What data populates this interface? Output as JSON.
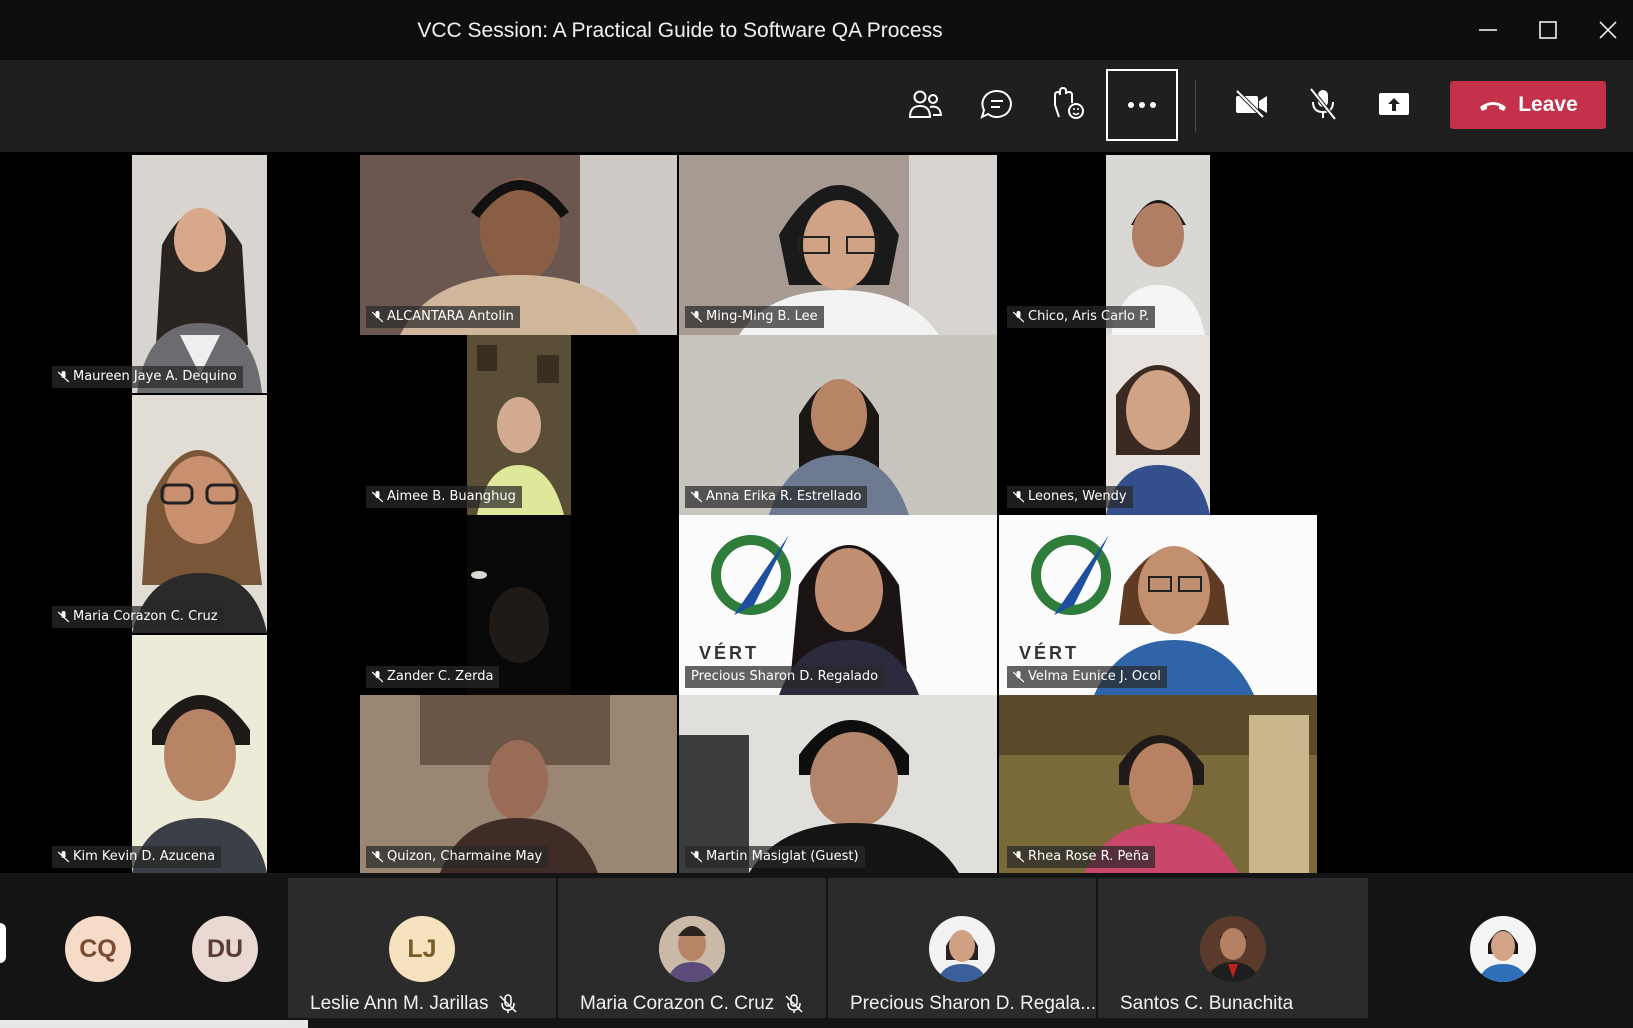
{
  "window": {
    "title": "VCC Session: A Practical Guide to Software QA Process"
  },
  "toolbar": {
    "icons": [
      "people-icon",
      "chat-icon",
      "reactions-icon",
      "more-icon",
      "camera-off-icon",
      "mic-off-icon",
      "share-icon",
      "phone-icon"
    ],
    "leave_label": "Leave",
    "leave_color": "#c4314b"
  },
  "video_tiles": [
    {
      "name": "Maureen Jaye A. Dequino"
    },
    {
      "name": "ALCANTARA Antolin"
    },
    {
      "name": "Ming-Ming B. Lee"
    },
    {
      "name": "Chico, Aris Carlo P."
    },
    {
      "name": "Aimee B. Buanghug"
    },
    {
      "name": "Anna Erika R. Estrellado"
    },
    {
      "name": "Leones, Wendy"
    },
    {
      "name": "Maria Corazon C. Cruz"
    },
    {
      "name": "Zander C. Zerda"
    },
    {
      "name": "Precious Sharon D. Regalado"
    },
    {
      "name": "Velma Eunice J. Ocol"
    },
    {
      "name": "Kim Kevin D. Azucena"
    },
    {
      "name": "Quizon, Charmaine May"
    },
    {
      "name": "Martin Masiglat (Guest)"
    },
    {
      "name": "Rhea Rose R. Peña"
    }
  ],
  "background_logo_text": "VÉRT",
  "participant_strip": [
    {
      "initials": "CQ",
      "color": "#f6dcc8",
      "text_color": "#7a4a35"
    },
    {
      "initials": "DU",
      "color": "#ead8d3",
      "text_color": "#5a3c36"
    },
    {
      "initials": "LJ",
      "name": "Leslie Ann M. Jarillas",
      "muted": true,
      "color": "#f7e2c0",
      "text_color": "#7a5a25"
    },
    {
      "name": "Maria Corazon C. Cruz",
      "muted": true
    },
    {
      "name": "Precious Sharon D. Regala..."
    },
    {
      "name": "Santos C. Bunachita"
    }
  ]
}
